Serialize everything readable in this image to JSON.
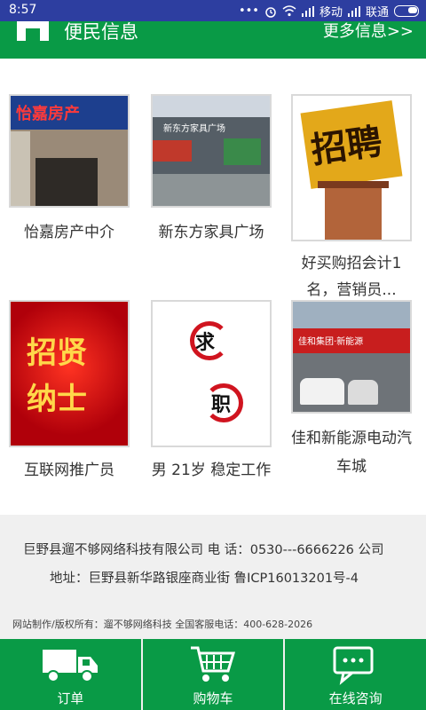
{
  "status_bar": {
    "time": "8:57",
    "carrier1": "移动",
    "carrier2": "联通"
  },
  "header": {
    "title": "便民信息",
    "more": "更多信息>>"
  },
  "cards": [
    {
      "label": "怡嘉房产中介",
      "image_text": "怡嘉房产"
    },
    {
      "label": "新东方家具广场",
      "image_text": "新东方家具广场"
    },
    {
      "label": "好买购招会计1名，营销员...",
      "image_text": "招聘"
    },
    {
      "label": "互联网推广员",
      "image_text_1": "招贤",
      "image_text_2": "纳士"
    },
    {
      "label": "男 21岁 稳定工作",
      "image_text_1": "求",
      "image_text_2": "职"
    },
    {
      "label": "佳和新能源电动汽车城",
      "image_text": "佳和集团·新能源"
    }
  ],
  "footer": {
    "line1": "巨野县遛不够网络科技有限公司 电 话：0530---6666226 公司",
    "line2": "地址：巨野县新华路银座商业街 鲁ICP16013201号-4",
    "line3": "网站制作/版权所有：遛不够网络科技    全国客服电话：400-628-2026"
  },
  "tabs": [
    {
      "label": "订单",
      "icon": "truck-icon"
    },
    {
      "label": "购物车",
      "icon": "cart-icon"
    },
    {
      "label": "在线咨询",
      "icon": "chat-icon"
    }
  ],
  "colors": {
    "status_bar": "#2d3ea0",
    "brand_green": "#099a46",
    "background": "#f0f0f0"
  }
}
